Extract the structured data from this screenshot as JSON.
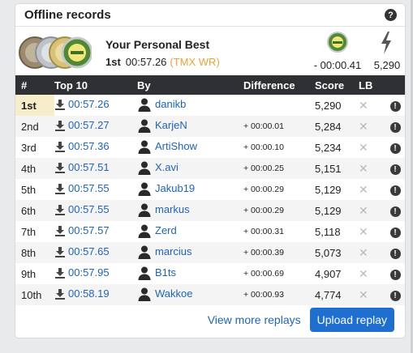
{
  "card": {
    "title": "Offline records",
    "help_icon": "question-circle-icon"
  },
  "personal_best": {
    "title": "Your Personal Best",
    "rank": "1st",
    "time": "00:57.26",
    "wr_badge": "(TMX WR)",
    "difference": "- 00:00.41",
    "score": "5,290",
    "medal_icon": "author-medal-icon",
    "score_icon": "lightning-bolt-icon"
  },
  "table": {
    "headers": {
      "rank": "#",
      "time": "Top 10",
      "by": "By",
      "difference": "Difference",
      "score": "Score",
      "lb": "LB"
    },
    "rows": [
      {
        "rank": "1st",
        "time": "00:57.26",
        "player": "danikb",
        "diff": "",
        "score": "5,290"
      },
      {
        "rank": "2nd",
        "time": "00:57.27",
        "player": "KarjeN",
        "diff": "+ 00:00.01",
        "score": "5,284"
      },
      {
        "rank": "3rd",
        "time": "00:57.36",
        "player": "ArtiShow",
        "diff": "+ 00:00.10",
        "score": "5,234"
      },
      {
        "rank": "4th",
        "time": "00:57.51",
        "player": "X.avi",
        "diff": "+ 00:00.25",
        "score": "5,151"
      },
      {
        "rank": "5th",
        "time": "00:57.55",
        "player": "Jakub19",
        "diff": "+ 00:00.29",
        "score": "5,129"
      },
      {
        "rank": "6th",
        "time": "00:57.55",
        "player": "markus",
        "diff": "+ 00:00.29",
        "score": "5,129"
      },
      {
        "rank": "7th",
        "time": "00:57.57",
        "player": "Zerd",
        "diff": "+ 00:00.31",
        "score": "5,118"
      },
      {
        "rank": "8th",
        "time": "00:57.65",
        "player": "marcius",
        "diff": "+ 00:00.39",
        "score": "5,073"
      },
      {
        "rank": "9th",
        "time": "00:57.95",
        "player": "B1ts",
        "diff": "+ 00:00.69",
        "score": "4,907"
      },
      {
        "rank": "10th",
        "time": "00:58.19",
        "player": "Wakkoe",
        "diff": "+ 00:00.93",
        "score": "4,774"
      }
    ]
  },
  "footer": {
    "view_more": "View more replays",
    "upload": "Upload replay"
  },
  "colors": {
    "link": "#1f64b8",
    "header_bg": "#2f3033",
    "first_row_highlight": "#f8edcb",
    "wr_badge": "#e8a33a",
    "upload_button": "#1f6fd1"
  }
}
